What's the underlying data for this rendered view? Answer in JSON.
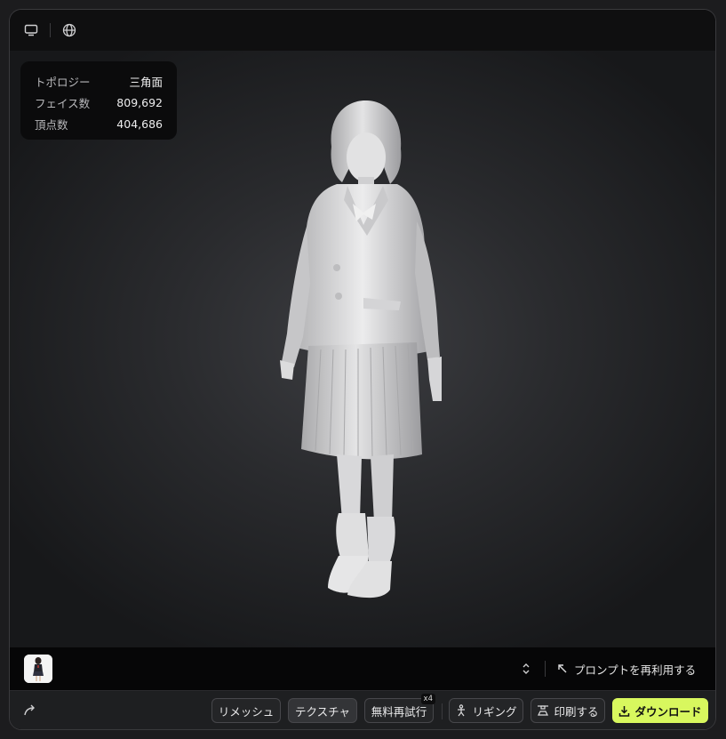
{
  "topbar": {
    "icons": [
      "monitor-icon",
      "globe-icon"
    ]
  },
  "stats": {
    "rows": [
      {
        "label": "トポロジー",
        "value": "三角面"
      },
      {
        "label": "フェイス数",
        "value": "809,692"
      },
      {
        "label": "頂点数",
        "value": "404,686"
      }
    ]
  },
  "bottom": {
    "reuse_prompt": "プロンプトを再利用する"
  },
  "toolbar": {
    "remesh": "リメッシュ",
    "texture": "テクスチャ",
    "free_retry": "無料再試行",
    "free_retry_badge": "x4",
    "rigging": "リギング",
    "print": "印刷する",
    "download": "ダウンロード"
  },
  "colors": {
    "accent": "#d8f75e",
    "background": "#0e0e0f"
  }
}
